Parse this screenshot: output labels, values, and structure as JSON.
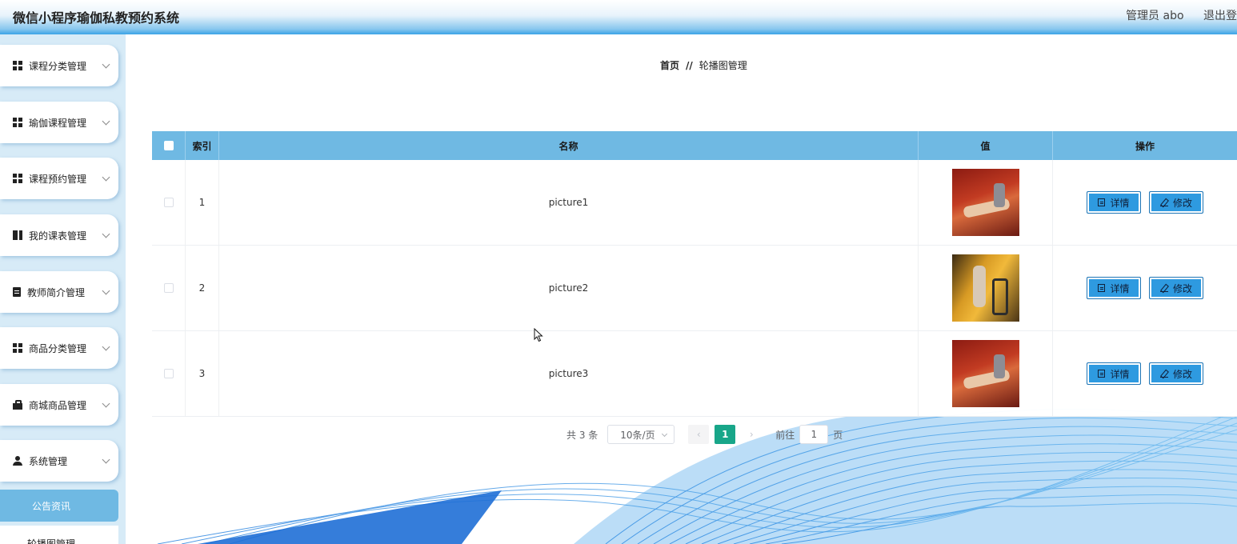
{
  "header": {
    "title": "微信小程序瑜伽私教预约系统",
    "admin": "管理员 abo",
    "logout": "退出登"
  },
  "sidebar": {
    "items": [
      {
        "label": "课程分类管理",
        "icon": "grid-icon"
      },
      {
        "label": "瑜伽课程管理",
        "icon": "grid-icon"
      },
      {
        "label": "课程预约管理",
        "icon": "grid-icon"
      },
      {
        "label": "我的课表管理",
        "icon": "book-icon"
      },
      {
        "label": "教师简介管理",
        "icon": "clipboard-icon"
      },
      {
        "label": "商品分类管理",
        "icon": "grid-icon"
      },
      {
        "label": "商城商品管理",
        "icon": "bag-icon"
      },
      {
        "label": "系统管理",
        "icon": "user-icon"
      }
    ],
    "sub_active": "公告资讯",
    "sub_item": "轮播图管理"
  },
  "breadcrumb": {
    "home": "首页",
    "separator": "//",
    "current": "轮播图管理"
  },
  "table": {
    "headers": {
      "index": "索引",
      "name": "名称",
      "value": "值",
      "actions": "操作"
    },
    "rows": [
      {
        "index": "1",
        "name": "picture1",
        "thumb": "red"
      },
      {
        "index": "2",
        "name": "picture2",
        "thumb": "yellow"
      },
      {
        "index": "3",
        "name": "picture3",
        "thumb": "red"
      }
    ],
    "detail_label": "详情",
    "edit_label": "修改"
  },
  "pagination": {
    "total": "共 3 条",
    "page_size": "10条/页",
    "current": "1",
    "goto_prefix": "前往",
    "goto_value": "1",
    "goto_suffix": "页",
    "prev": "‹",
    "next": "›"
  },
  "colors": {
    "header_blue": "#3aa3e6",
    "table_header": "#6fb9e3",
    "button": "#2e9ae0",
    "page_active": "#18a689"
  }
}
